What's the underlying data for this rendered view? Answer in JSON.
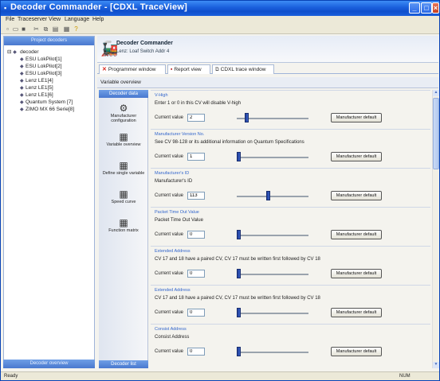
{
  "window": {
    "title": "Decoder Commander - [CDXL TraceView]"
  },
  "menu": [
    "File",
    "Traceserver",
    "View",
    "Language",
    "Help"
  ],
  "toolbar_icons": [
    "new-icon",
    "open-icon",
    "save-icon",
    "cut-icon",
    "copy-icon",
    "paste-icon",
    "print-icon",
    "help-icon"
  ],
  "left": {
    "header": "Project decoders",
    "root": "decoder",
    "items": [
      "ESU LokPilot[1]",
      "ESU LokPilot[2]",
      "ESU LokPilot[3]",
      "Lenz LE1[4]",
      "Lenz LE1[5]",
      "Lenz LE1[6]",
      "Quantum System [7]",
      "ZIMO MX 66 Serie[8]"
    ],
    "footer": "Decoder overview"
  },
  "decoder": {
    "title": "Decoder Commander",
    "subtitle": "Lenz: Loaf Switch Addr 4"
  },
  "tabs": [
    "Programmer window",
    "Report view",
    "CDXL trace window"
  ],
  "variable_overview": "Variable overview",
  "nav": {
    "header": "Decoder data",
    "items": [
      "Manufacturer configuration",
      "Variable overview",
      "Define single variable",
      "Speed curve",
      "Function matrix"
    ],
    "footer": "Decoder list"
  },
  "current_value_label": "Current value",
  "manufacturer_default_label": "Manufacturer default",
  "sections": [
    {
      "title": "V-High",
      "desc": "Enter 1 or 0 in this CV will disable V-high",
      "value": "2",
      "level": 0.12
    },
    {
      "title": "Manufacturer Version No.",
      "desc": "See CV 98-128 or its additional information on Quantum Specifications",
      "value": "1",
      "level": 0.0
    },
    {
      "title": "Manufacturer's ID",
      "desc": "Manufacturer's ID",
      "value": "113",
      "level": 0.44
    },
    {
      "title": "Packet Time Out Value",
      "desc": "Packet Time Out Value",
      "value": "0",
      "level": 0.0
    },
    {
      "title": "Extended Address",
      "desc": "CV 17 and 18 have a paired CV, CV 17 must be written first followed by CV 18",
      "value": "0",
      "level": 0.0
    },
    {
      "title": "Extended Address",
      "desc": "CV 17 and 18 have a paired CV, CV 17 must be written first followed by CV 18",
      "value": "0",
      "level": 0.0
    },
    {
      "title": "Consist Address",
      "desc": "Consist Address",
      "value": "0",
      "level": 0.0
    }
  ],
  "status": {
    "left": "Ready",
    "right": "NUM"
  }
}
